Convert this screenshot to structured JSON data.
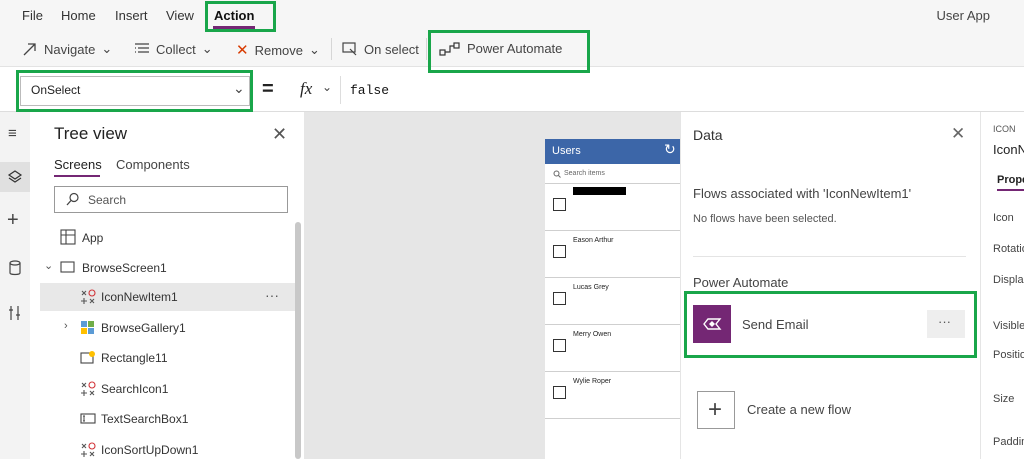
{
  "menubar": {
    "items": [
      "File",
      "Home",
      "Insert",
      "View",
      "Action"
    ],
    "right_label": "User App"
  },
  "toolbar": {
    "navigate": "Navigate",
    "collect": "Collect",
    "remove": "Remove",
    "on_select": "On select",
    "power_automate": "Power Automate"
  },
  "formula": {
    "property": "OnSelect",
    "equals": "=",
    "fx": "fx",
    "value": "false"
  },
  "tree": {
    "title": "Tree view",
    "tabs": [
      "Screens",
      "Components"
    ],
    "search_placeholder": "Search",
    "items": [
      {
        "label": "App",
        "icon": "app-icon"
      },
      {
        "label": "BrowseScreen1",
        "icon": "screen-icon"
      },
      {
        "label": "IconNewItem1",
        "icon": "icon-control-icon",
        "more": "···"
      },
      {
        "label": "BrowseGallery1",
        "icon": "gallery-icon"
      },
      {
        "label": "Rectangle11",
        "icon": "rectangle-icon"
      },
      {
        "label": "SearchIcon1",
        "icon": "icon-control-icon"
      },
      {
        "label": "TextSearchBox1",
        "icon": "textbox-icon"
      },
      {
        "label": "IconSortUpDown1",
        "icon": "icon-control-icon"
      }
    ]
  },
  "canvas": {
    "app_title": "Users",
    "search_placeholder": "Search items",
    "users": [
      "Eason Arthur",
      "Lucas Grey",
      "Merry Owen",
      "Wylie Roper"
    ]
  },
  "data_pane": {
    "title": "Data",
    "flows_heading": "Flows associated with 'IconNewItem1'",
    "no_flows": "No flows have been selected.",
    "section": "Power Automate",
    "flow_name": "Send Email",
    "more": "···",
    "create": "Create a new flow"
  },
  "props_pane": {
    "type": "ICON",
    "name": "IconN",
    "tab": "Prope",
    "rows": [
      "Icon",
      "Rotatio",
      "Displa",
      "Visible",
      "Positio",
      "Size",
      "Paddin"
    ]
  },
  "colors": {
    "accent": "#742774",
    "highlight": "#19a64a",
    "app_header": "#3c66a8"
  }
}
